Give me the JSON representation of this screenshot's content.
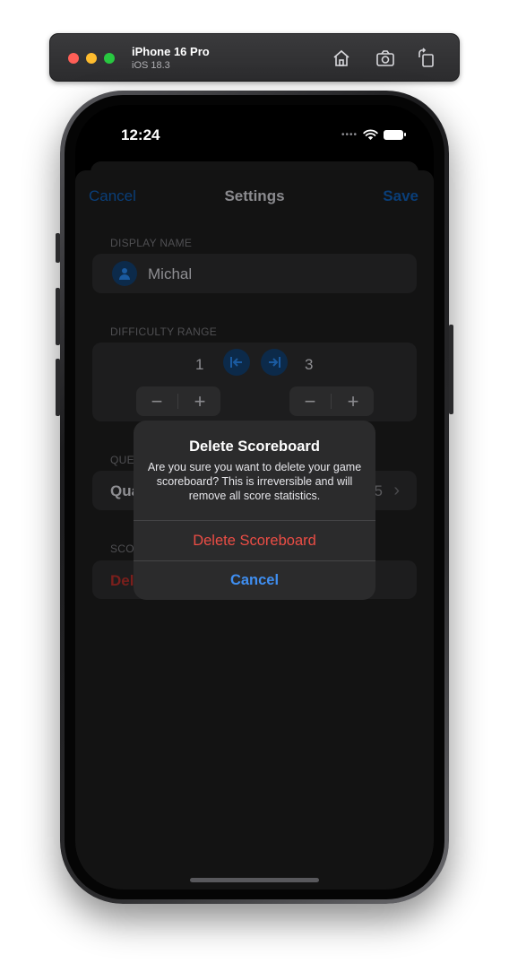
{
  "simulator": {
    "device_name": "iPhone 16 Pro",
    "os_version": "iOS 18.3",
    "icons": [
      "home-icon",
      "screenshot-icon",
      "rotate-icon"
    ]
  },
  "status_bar": {
    "time": "12:24",
    "signal": "••••"
  },
  "nav": {
    "cancel_label": "Cancel",
    "title": "Settings",
    "save_label": "Save"
  },
  "sections": {
    "display_name": {
      "header": "DISPLAY NAME",
      "value": "Michal"
    },
    "difficulty_range": {
      "header": "DIFFICULTY RANGE",
      "min": "1",
      "max": "3",
      "minus_label": "−",
      "plus_label": "+"
    },
    "questions": {
      "header_visible": "QUE",
      "row_label_visible": "Qua",
      "row_value_visible": "5",
      "chevron": "›"
    },
    "scoreboard": {
      "header_visible": "SCO",
      "row_label_visible": "Del"
    }
  },
  "alert": {
    "title": "Delete Scoreboard",
    "message": "Are you sure you want to delete your game scoreboard? This is irreversible and will remove all score statistics.",
    "destructive_label": "Delete Scoreboard",
    "cancel_label": "Cancel"
  },
  "colors": {
    "accent_blue": "#3f8ef0",
    "destructive_red": "#eb4d45"
  }
}
